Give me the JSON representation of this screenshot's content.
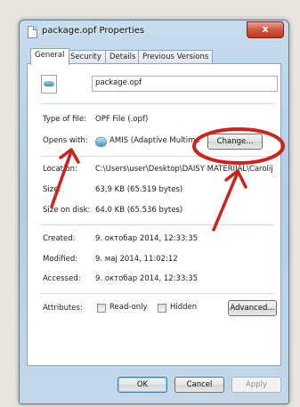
{
  "window": {
    "title": "package.opf Properties",
    "close_label": "x"
  },
  "tabs": [
    {
      "label": "General",
      "active": true
    },
    {
      "label": "Security",
      "active": false
    },
    {
      "label": "Details",
      "active": false
    },
    {
      "label": "Previous Versions",
      "active": false
    }
  ],
  "general": {
    "file_name": "package.opf",
    "type_label": "Type of file:",
    "type_value": "OPF File (.opf)",
    "opens_label": "Opens with:",
    "opens_value": "AMIS (Adaptive Multime",
    "change_label": "Change...",
    "location_label": "Location:",
    "location_value": "C:\\Users\\user\\Desktop\\DAISY MATERIJAL\\Carolij",
    "size_label": "Size:",
    "size_value": "63,9 KB (65.519 bytes)",
    "size_disk_label": "Size on disk:",
    "size_disk_value": "64,0 KB (65.536 bytes)",
    "created_label": "Created:",
    "created_value": "9. октобар 2014, 12:33:35",
    "modified_label": "Modified:",
    "modified_value": "9. мај 2014, 11:02:12",
    "accessed_label": "Accessed:",
    "accessed_value": "9. октобар 2014, 12:33:35",
    "attributes_label": "Attributes:",
    "readonly_label": "Read-only",
    "hidden_label": "Hidden",
    "advanced_label": "Advanced..."
  },
  "footer": {
    "ok_label": "OK",
    "cancel_label": "Cancel",
    "apply_label": "Apply"
  },
  "colors": {
    "annotation": "#d0221b",
    "titlebar": "#b3cde3",
    "close": "#c2371f"
  }
}
